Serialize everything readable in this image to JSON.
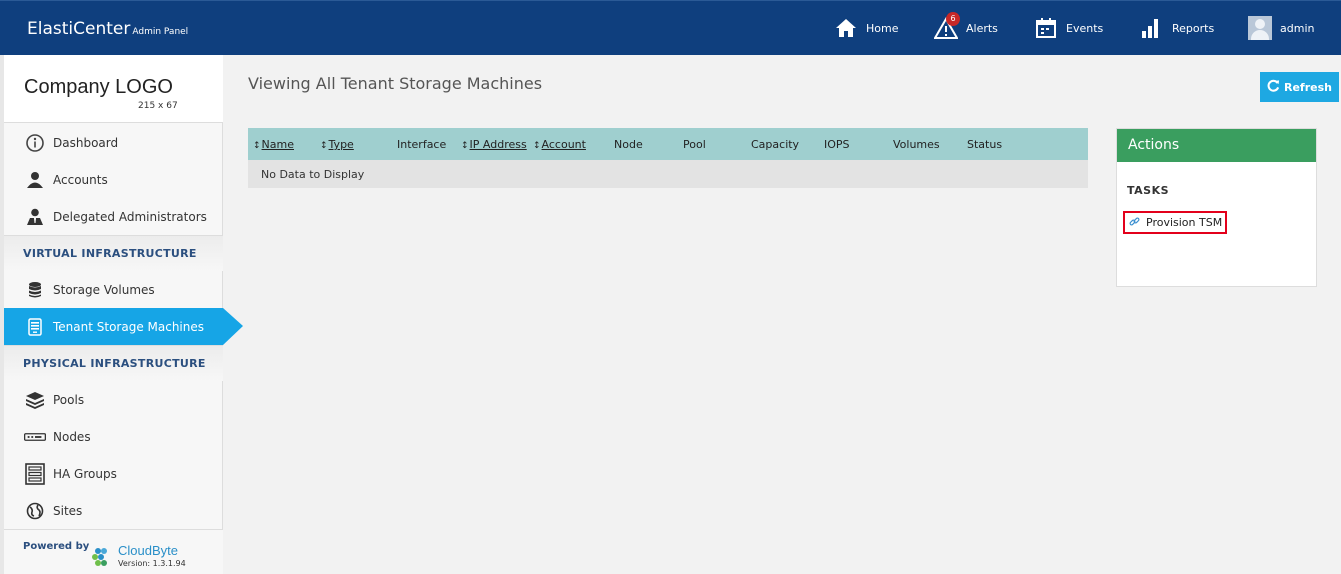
{
  "header": {
    "app_name": "ElastiCenter",
    "app_sub": "Admin Panel",
    "nav": [
      {
        "label": "Home",
        "icon": "home-icon"
      },
      {
        "label": "Alerts",
        "icon": "alert-icon",
        "badge": "6"
      },
      {
        "label": "Events",
        "icon": "calendar-icon"
      },
      {
        "label": "Reports",
        "icon": "bar-chart-icon"
      },
      {
        "label": "admin",
        "icon": "avatar"
      }
    ],
    "colors": {
      "bar": "#0f3f7e"
    }
  },
  "sidebar": {
    "logo_text": "Company LOGO",
    "logo_size": "215 x 67",
    "items_top": [
      {
        "label": "Dashboard",
        "icon": "dashboard-icon"
      },
      {
        "label": "Accounts",
        "icon": "user-icon"
      },
      {
        "label": "Delegated Administrators",
        "icon": "admin-icon"
      }
    ],
    "section_virtual": "VIRTUAL INFRASTRUCTURE",
    "items_virtual": [
      {
        "label": "Storage Volumes",
        "icon": "database-icon"
      },
      {
        "label": "Tenant Storage Machines",
        "icon": "server-icon",
        "active": true
      }
    ],
    "section_physical": "PHYSICAL INFRASTRUCTURE",
    "items_physical": [
      {
        "label": "Pools",
        "icon": "layers-icon"
      },
      {
        "label": "Nodes",
        "icon": "node-icon"
      },
      {
        "label": "HA Groups",
        "icon": "rack-icon"
      },
      {
        "label": "Sites",
        "icon": "globe-icon"
      }
    ],
    "powered_by": "Powered by",
    "brand": "CloudByte",
    "version": "Version: 1.3.1.94",
    "colors": {
      "active": "#16a5e6",
      "section_text": "#2b4f7f"
    }
  },
  "main": {
    "title": "Viewing All Tenant Storage Machines",
    "refresh_label": "Refresh",
    "columns": [
      {
        "label": "Name",
        "sortable": true
      },
      {
        "label": "Type",
        "sortable": true
      },
      {
        "label": "Interface",
        "sortable": false
      },
      {
        "label": "IP Address",
        "sortable": true
      },
      {
        "label": "Account",
        "sortable": true
      },
      {
        "label": "Node",
        "sortable": false
      },
      {
        "label": "Pool",
        "sortable": false
      },
      {
        "label": "Capacity",
        "sortable": false
      },
      {
        "label": "IOPS",
        "sortable": false
      },
      {
        "label": "Volumes",
        "sortable": false
      },
      {
        "label": "Status",
        "sortable": false
      }
    ],
    "empty_message": "No Data to Display",
    "colors": {
      "grid_head": "#9fcfcf",
      "refresh": "#1ea8e2"
    }
  },
  "actions": {
    "title": "Actions",
    "tasks_label": "TASKS",
    "tasks": [
      {
        "label": "Provision TSM",
        "icon": "link-icon"
      }
    ],
    "colors": {
      "head": "#3a9e5f",
      "highlight": "#e3001b"
    }
  }
}
